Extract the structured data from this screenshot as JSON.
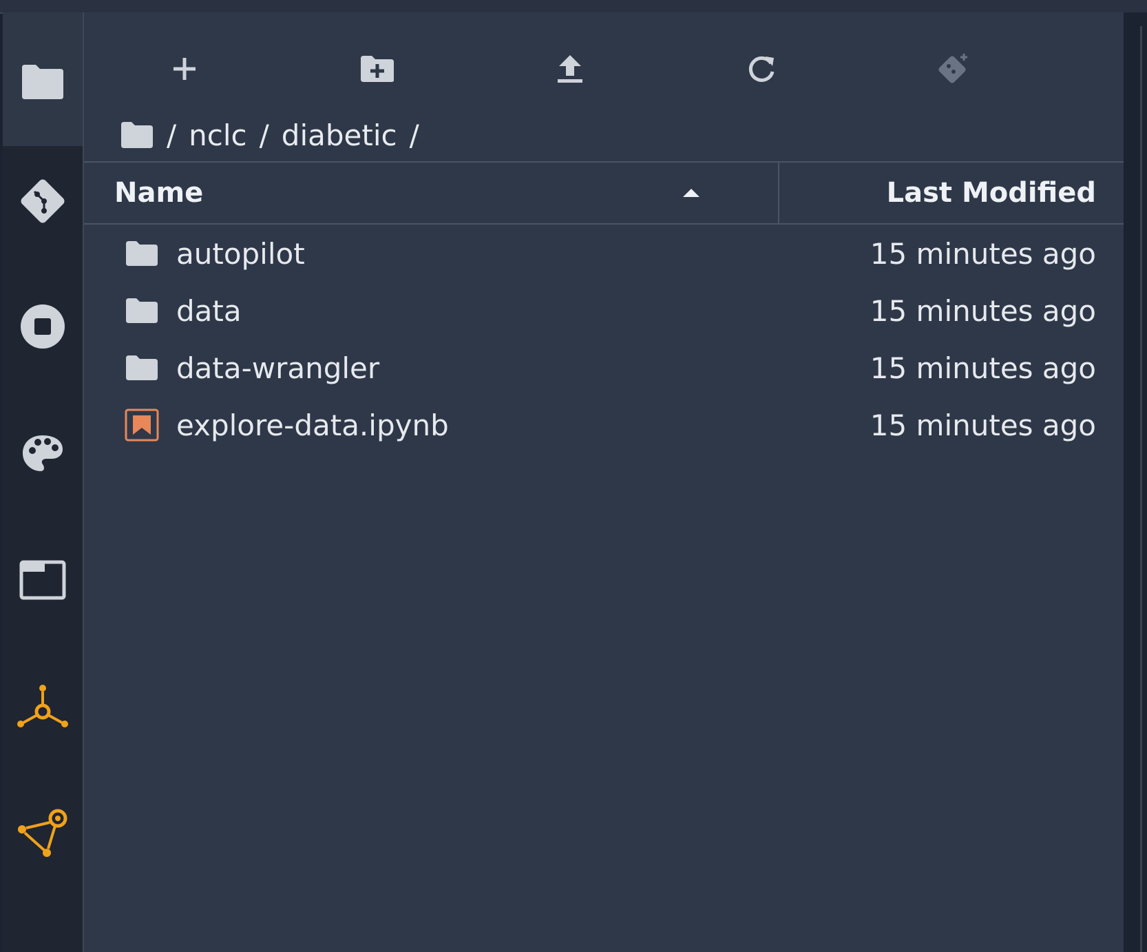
{
  "colors": {
    "panel_bg": "#2f3848",
    "sidebar_bg": "#1f2531",
    "text": "#e6e9ee",
    "icon_gray": "#cfd3da",
    "accent_orange": "#f0a21a",
    "notebook_orange": "#e8875a"
  },
  "sidebar": {
    "items": [
      {
        "icon": "folder-icon",
        "active": true
      },
      {
        "icon": "git-icon"
      },
      {
        "icon": "stop-circle-icon"
      },
      {
        "icon": "palette-icon"
      },
      {
        "icon": "window-tabs-icon"
      },
      {
        "icon": "network-nodes-icon"
      },
      {
        "icon": "pipeline-graph-icon"
      }
    ]
  },
  "toolbar": {
    "buttons": [
      {
        "icon": "plus-icon"
      },
      {
        "icon": "new-folder-icon"
      },
      {
        "icon": "upload-icon"
      },
      {
        "icon": "refresh-icon"
      },
      {
        "icon": "git-clone-icon",
        "disabled": true
      }
    ]
  },
  "breadcrumb": {
    "icon": "folder-icon",
    "parts": [
      "/",
      "nclc",
      "/",
      "diabetic",
      "/"
    ]
  },
  "table": {
    "columns": {
      "name": "Name",
      "modified": "Last Modified"
    },
    "sort": "ascending",
    "rows": [
      {
        "name": "autopilot",
        "modified": "15 minutes ago",
        "type": "folder"
      },
      {
        "name": "data",
        "modified": "15 minutes ago",
        "type": "folder"
      },
      {
        "name": "data-wrangler",
        "modified": "15 minutes ago",
        "type": "folder"
      },
      {
        "name": "explore-data.ipynb",
        "modified": "15 minutes ago",
        "type": "notebook"
      }
    ]
  }
}
